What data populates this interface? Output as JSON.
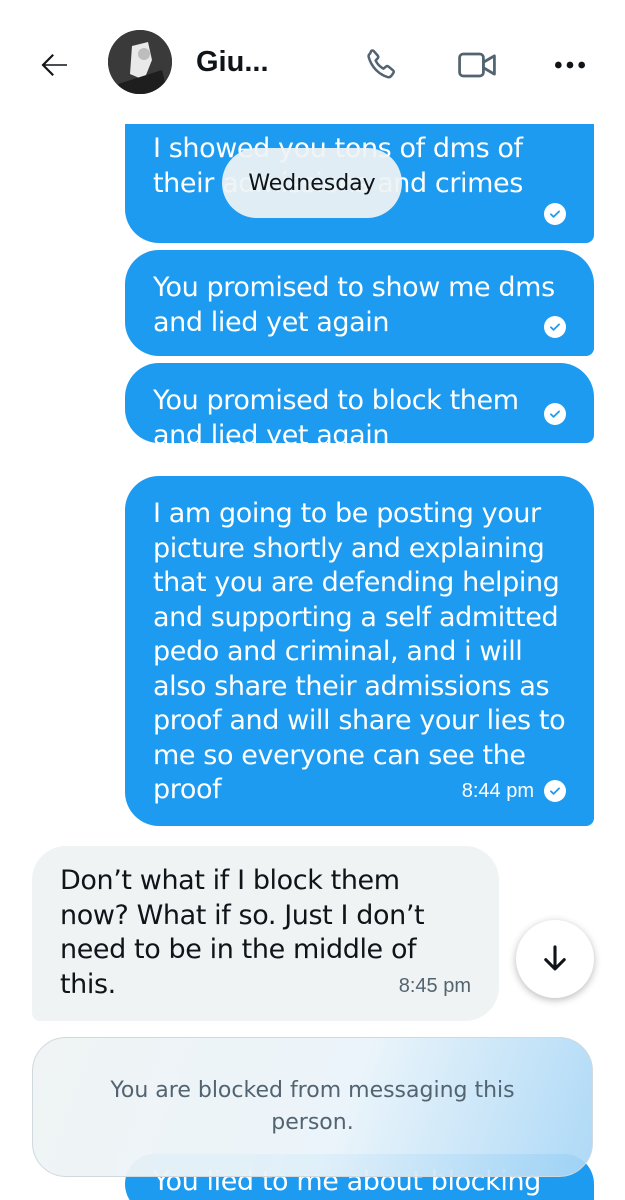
{
  "header": {
    "contact_name": "Giu...",
    "icons": {
      "back": "arrow-left-icon",
      "call": "phone-icon",
      "video": "video-camera-icon",
      "more": "more-horizontal-icon"
    }
  },
  "date_separator": "Wednesday",
  "messages": [
    {
      "direction": "outgoing",
      "text": "I showed you tons of dms of\ntheir admissions and crimes",
      "time": "",
      "read": true
    },
    {
      "direction": "outgoing",
      "text": "You promised to show me dms\nand lied yet again",
      "time": "",
      "read": true
    },
    {
      "direction": "outgoing",
      "text": "You promised to block them\nand lied yet again",
      "time": "",
      "read": true
    },
    {
      "direction": "outgoing",
      "text": "I am going to be posting your\npicture shortly and explaining\nthat you are defending helping\nand supporting a self admitted\npedo and criminal, and i will\nalso share their admissions as\nproof and will share your lies to\nme so everyone can see the\nproof",
      "time": "8:44 pm",
      "read": true
    },
    {
      "direction": "incoming",
      "text": "Don’t what if I block them\nnow? What if so. Just I don’t\nneed to be in the middle of\nthis.",
      "time": "8:45 pm",
      "read": false
    },
    {
      "direction": "outgoing",
      "text": "You lied to me about blocking",
      "time": "",
      "read": false
    }
  ],
  "blocked_notice": "You are blocked from messaging this person.",
  "colors": {
    "outgoing_bubble": "#1d9bf0",
    "incoming_bubble": "#eff3f4",
    "muted_text": "#536471"
  }
}
